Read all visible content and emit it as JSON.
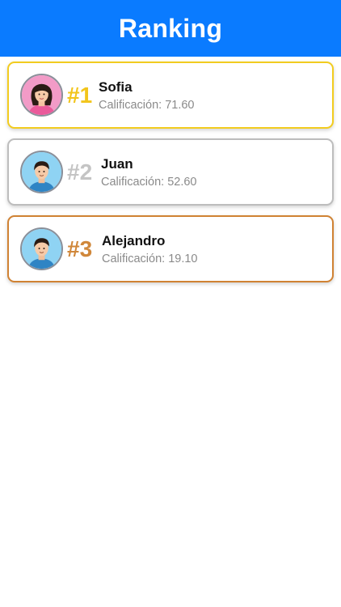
{
  "header": {
    "title": "Ranking"
  },
  "ranking": [
    {
      "rank": "#1",
      "name": "Sofia",
      "score": "Calificación: 71.60",
      "avatar": "female-avatar-icon",
      "medal_color": "#f2cc1f"
    },
    {
      "rank": "#2",
      "name": "Juan",
      "score": "Calificación: 52.60",
      "avatar": "male-avatar-icon",
      "medal_color": "#bdbdbd"
    },
    {
      "rank": "#3",
      "name": "Alejandro",
      "score": "Calificación: 19.10",
      "avatar": "male-avatar-icon",
      "medal_color": "#d08233"
    }
  ],
  "colors": {
    "accent": "#0a7bff",
    "gold": "#f2cc1f",
    "silver": "#bdbdbd",
    "bronze": "#d08233"
  }
}
